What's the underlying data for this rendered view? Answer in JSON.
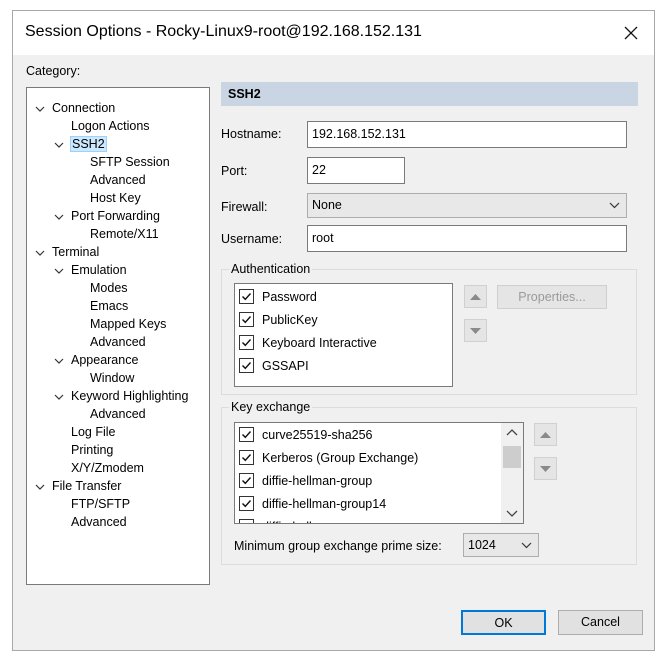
{
  "window": {
    "title": "Session Options - Rocky-Linux9-root@192.168.152.131"
  },
  "category_label": "Category:",
  "tree": [
    {
      "label": "Connection",
      "level": 0,
      "expander": "expanded"
    },
    {
      "label": "Logon Actions",
      "level": 1,
      "expander": "none"
    },
    {
      "label": "SSH2",
      "level": 1,
      "expander": "expanded",
      "selected": true
    },
    {
      "label": "SFTP Session",
      "level": 2,
      "expander": "none"
    },
    {
      "label": "Advanced",
      "level": 2,
      "expander": "none"
    },
    {
      "label": "Host Key",
      "level": 2,
      "expander": "none"
    },
    {
      "label": "Port Forwarding",
      "level": 1,
      "expander": "expanded"
    },
    {
      "label": "Remote/X11",
      "level": 2,
      "expander": "none"
    },
    {
      "label": "Terminal",
      "level": 0,
      "expander": "expanded"
    },
    {
      "label": "Emulation",
      "level": 1,
      "expander": "expanded"
    },
    {
      "label": "Modes",
      "level": 2,
      "expander": "none"
    },
    {
      "label": "Emacs",
      "level": 2,
      "expander": "none"
    },
    {
      "label": "Mapped Keys",
      "level": 2,
      "expander": "none"
    },
    {
      "label": "Advanced",
      "level": 2,
      "expander": "none"
    },
    {
      "label": "Appearance",
      "level": 1,
      "expander": "expanded"
    },
    {
      "label": "Window",
      "level": 2,
      "expander": "none"
    },
    {
      "label": "Keyword Highlighting",
      "level": 1,
      "expander": "expanded"
    },
    {
      "label": "Advanced",
      "level": 2,
      "expander": "none"
    },
    {
      "label": "Log File",
      "level": 1,
      "expander": "none"
    },
    {
      "label": "Printing",
      "level": 1,
      "expander": "none"
    },
    {
      "label": "X/Y/Zmodem",
      "level": 1,
      "expander": "none"
    },
    {
      "label": "File Transfer",
      "level": 0,
      "expander": "expanded"
    },
    {
      "label": "FTP/SFTP",
      "level": 1,
      "expander": "none"
    },
    {
      "label": "Advanced",
      "level": 1,
      "expander": "none"
    }
  ],
  "panel": {
    "header": "SSH2",
    "hostname": {
      "label": "Hostname:",
      "value": "192.168.152.131"
    },
    "port": {
      "label": "Port:",
      "value": "22"
    },
    "firewall": {
      "label": "Firewall:",
      "value": "None"
    },
    "username": {
      "label": "Username:",
      "value": "root"
    },
    "authentication": {
      "label": "Authentication",
      "items": [
        {
          "label": "Password",
          "checked": true
        },
        {
          "label": "PublicKey",
          "checked": true
        },
        {
          "label": "Keyboard Interactive",
          "checked": true
        },
        {
          "label": "GSSAPI",
          "checked": true
        }
      ],
      "properties_button": "Properties..."
    },
    "key_exchange": {
      "label": "Key exchange",
      "items": [
        {
          "label": "curve25519-sha256",
          "checked": true
        },
        {
          "label": "Kerberos (Group Exchange)",
          "checked": true
        },
        {
          "label": "diffie-hellman-group",
          "checked": true
        },
        {
          "label": "diffie-hellman-group14",
          "checked": true
        },
        {
          "label": "diffie-hellman",
          "checked": true
        }
      ],
      "min_prime_label": "Minimum group exchange prime size:",
      "min_prime_value": "1024"
    }
  },
  "buttons": {
    "ok": "OK",
    "cancel": "Cancel"
  },
  "colors": {
    "selection": "#cce8ff",
    "header_band": "#c9d5e2",
    "ok_border": "#0078d7"
  }
}
